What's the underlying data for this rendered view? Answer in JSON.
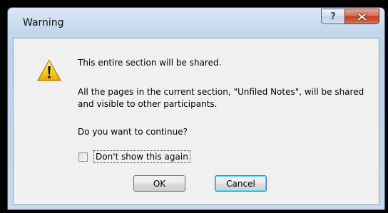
{
  "window": {
    "title": "Warning",
    "help_glyph": "?",
    "close_glyph": "X"
  },
  "icons": {
    "warning": "warning-triangle-icon",
    "help": "question-mark-icon",
    "close": "close-icon"
  },
  "colors": {
    "close_button": "#c7462f",
    "warning_icon": "#f4c21d",
    "default_button_highlight": "#3c7fb1"
  },
  "message": {
    "line1": "This entire section will be shared.",
    "line2": "All the pages in the current section, \"Unfiled Notes\", will be shared and visible to other participants.",
    "question": "Do you want to continue?"
  },
  "checkbox": {
    "label": "Don't show this again",
    "checked": false
  },
  "buttons": {
    "ok": "OK",
    "cancel": "Cancel"
  }
}
